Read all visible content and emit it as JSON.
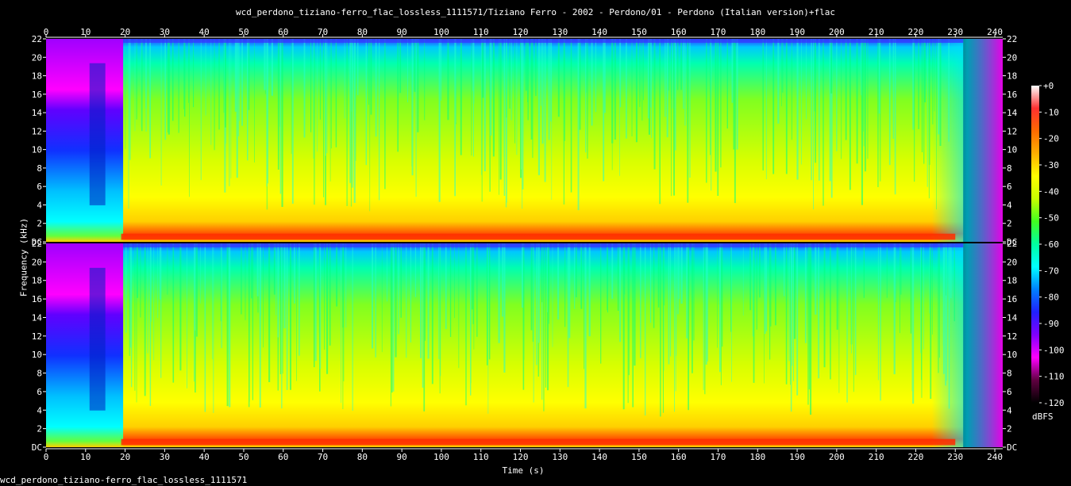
{
  "title": "wcd_perdono_tiziano-ferro_flac_lossless_1111571/Tiziano Ferro - 2002 - Perdono/01 - Perdono (Italian version)+flac",
  "footer": "wcd_perdono_tiziano-ferro_flac_lossless_1111571",
  "chart_data": {
    "type": "heatmap",
    "title": "wcd_perdono_tiziano-ferro_flac_lossless_1111571/Tiziano Ferro - 2002 - Perdono/01 - Perdono (Italian version)+flac",
    "xlabel": "Time (s)",
    "ylabel": "Frequency (kHz)",
    "xlim": [
      0,
      242
    ],
    "ylim": [
      0,
      22
    ],
    "x_ticks": [
      0,
      10,
      20,
      30,
      40,
      50,
      60,
      70,
      80,
      90,
      100,
      110,
      120,
      130,
      140,
      150,
      160,
      170,
      180,
      190,
      200,
      210,
      220,
      230,
      240
    ],
    "y_ticks": [
      {
        "value": 0,
        "label": "DC"
      },
      {
        "value": 2,
        "label": "2"
      },
      {
        "value": 4,
        "label": "4"
      },
      {
        "value": 6,
        "label": "6"
      },
      {
        "value": 8,
        "label": "8"
      },
      {
        "value": 10,
        "label": "10"
      },
      {
        "value": 12,
        "label": "12"
      },
      {
        "value": 14,
        "label": "14"
      },
      {
        "value": 16,
        "label": "16"
      },
      {
        "value": 18,
        "label": "18"
      },
      {
        "value": 20,
        "label": "20"
      },
      {
        "value": 22,
        "label": "22"
      }
    ],
    "channels": 2,
    "colorbar": {
      "label": "dBFS",
      "range": [
        -120,
        0
      ],
      "ticks": [
        {
          "value": 0,
          "label": "+0"
        },
        {
          "value": -10,
          "label": "-10"
        },
        {
          "value": -20,
          "label": "-20"
        },
        {
          "value": -30,
          "label": "-30"
        },
        {
          "value": -40,
          "label": "-40"
        },
        {
          "value": -50,
          "label": "-50"
        },
        {
          "value": -60,
          "label": "-60"
        },
        {
          "value": -70,
          "label": "-70"
        },
        {
          "value": -80,
          "label": "-80"
        },
        {
          "value": -90,
          "label": "-90"
        },
        {
          "value": -100,
          "label": "-100"
        },
        {
          "value": -110,
          "label": "-110"
        },
        {
          "value": -120,
          "label": "-120"
        }
      ],
      "stops": [
        "#ffffff",
        "#ff3030",
        "#ff6a00",
        "#ffb000",
        "#ffff00",
        "#c8ff00",
        "#40ff20",
        "#00ffa0",
        "#00ffff",
        "#0080ff",
        "#2020ff",
        "#8000ff",
        "#ff00ff",
        "#600040",
        "#000000"
      ]
    }
  }
}
